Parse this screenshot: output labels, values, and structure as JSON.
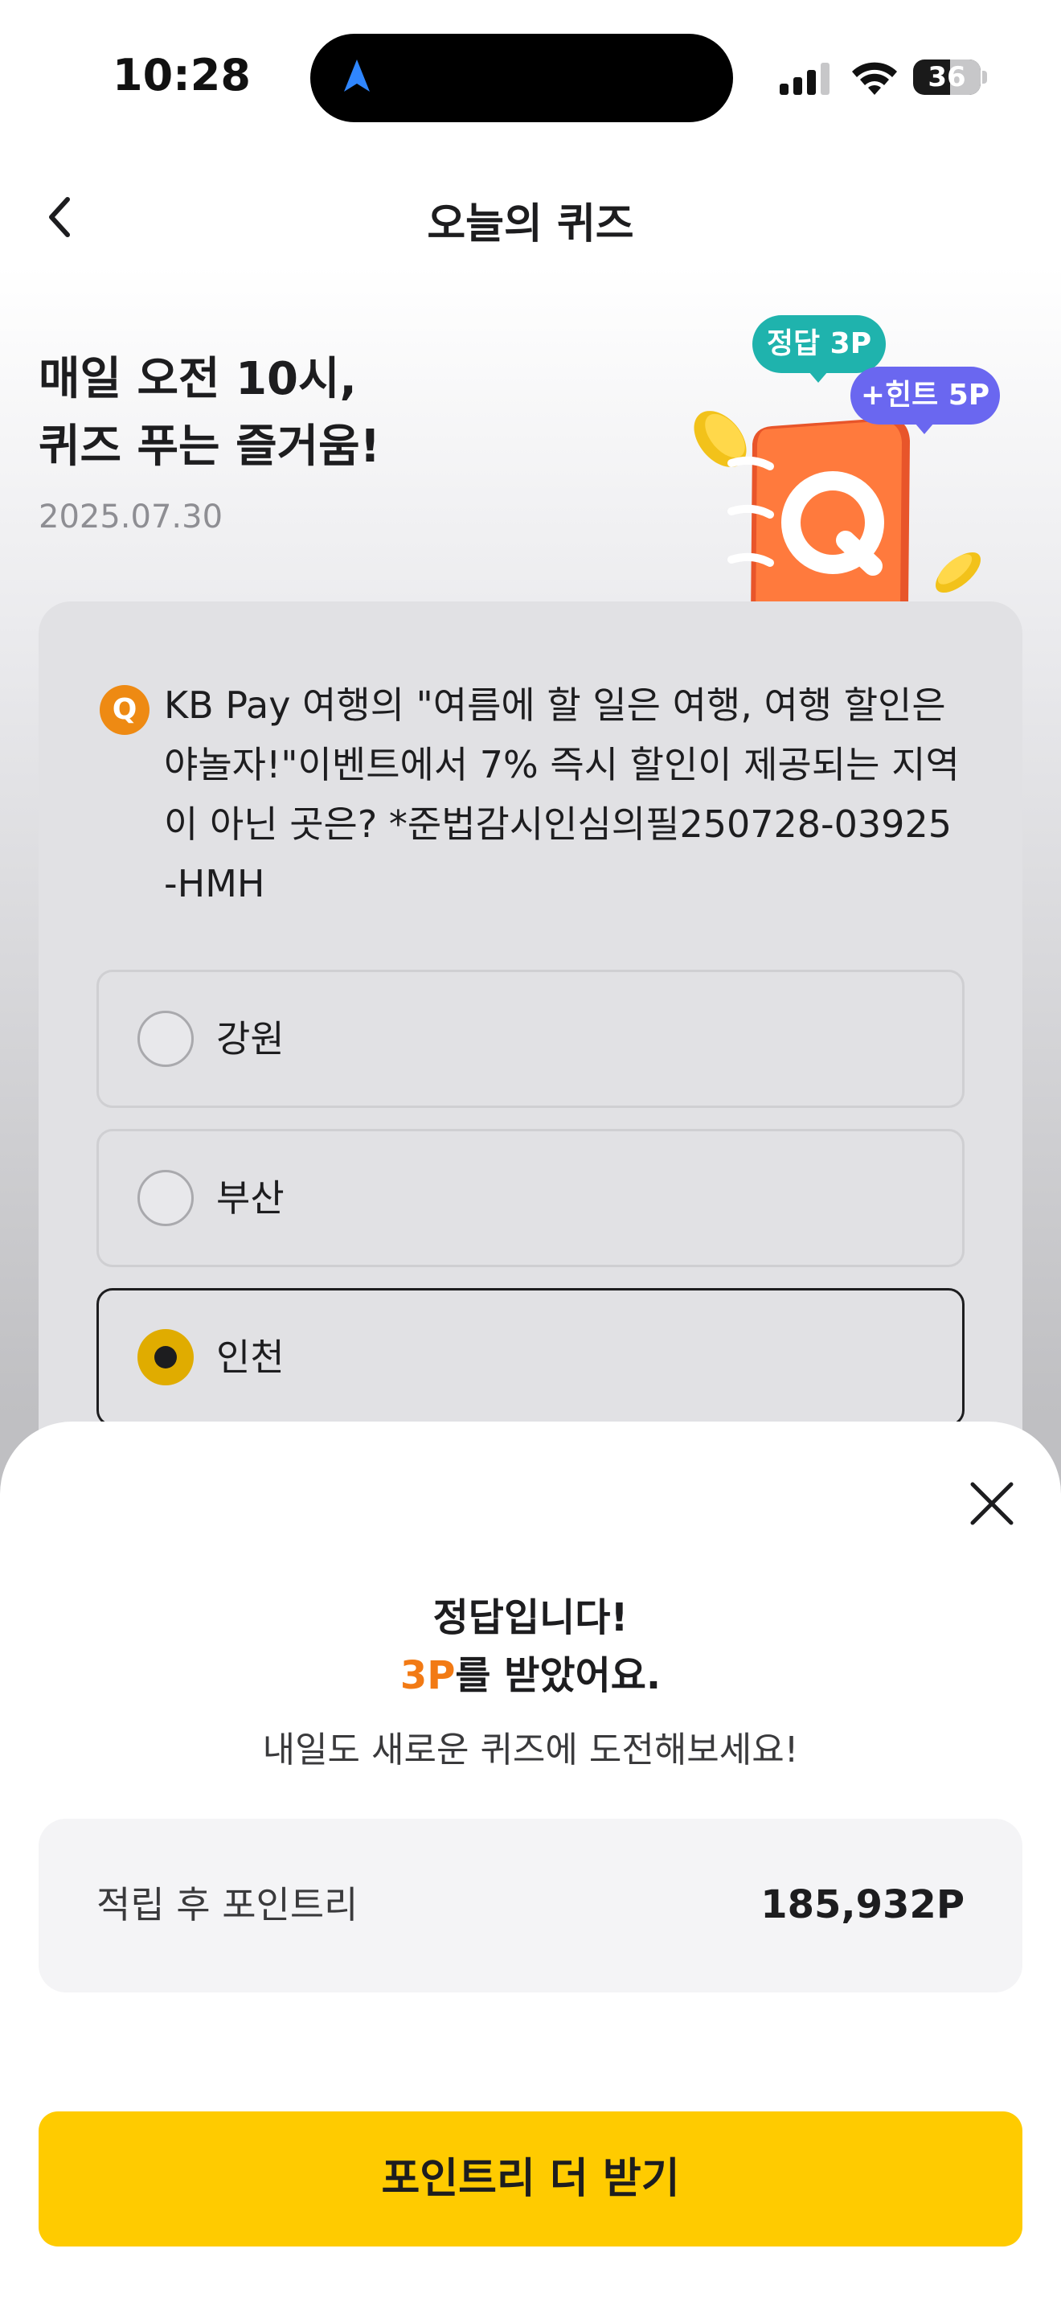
{
  "status_bar": {
    "time": "10:28",
    "battery": "36"
  },
  "nav": {
    "title": "오늘의 퀴즈"
  },
  "hero": {
    "title_line1": "매일 오전 10시,",
    "title_line2": "퀴즈 푸는 즐거움!",
    "date": "2025.07.30",
    "badge_answer": "정답 3P",
    "badge_hint": "+힌트 5P"
  },
  "quiz": {
    "q_icon": "Q",
    "question": "KB Pay 여행의 \"여름에 할 일은 여행, 여행 할인은 야놀자!\"이벤트에서 7% 즉시 할인이 제공되는 지역이 아닌 곳은? *준법감시인심의필250728-03925-HMH",
    "options": [
      {
        "label": "강원",
        "selected": false
      },
      {
        "label": "부산",
        "selected": false
      },
      {
        "label": "인천",
        "selected": true
      }
    ]
  },
  "result_sheet": {
    "title": "정답입니다!",
    "reward_amount": "3P",
    "reward_suffix": "를 받았어요.",
    "description": "내일도 새로운 퀴즈에 도전해보세요!",
    "points_label": "적립 후 포인트리",
    "points_value": "185,932P",
    "cta_label": "포인트리 더 받기"
  },
  "colors": {
    "accent_orange": "#f27a14",
    "cta_yellow": "#ffcb00",
    "badge_teal": "#1fb3ad",
    "badge_purple": "#6a67f0",
    "radio_selected": "#e0ac00"
  },
  "icons": {
    "back": "chevron-left-icon",
    "close": "close-icon",
    "status_nav": "location-arrow-icon",
    "signal": "cellular-signal-icon",
    "wifi": "wifi-icon",
    "battery": "battery-icon",
    "illustration": "quiz-notebook-illustration"
  }
}
